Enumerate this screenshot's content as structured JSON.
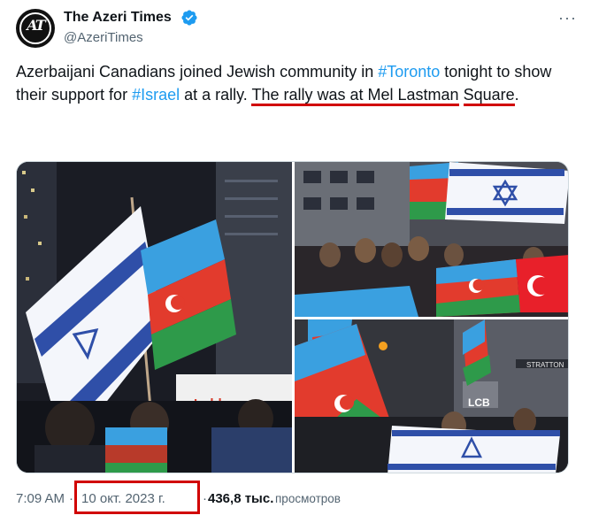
{
  "author": {
    "name": "The Azeri Times",
    "handle": "@AzeriTimes",
    "avatar_text": "AT"
  },
  "tweet": {
    "part1": "Azerbaijani Canadians joined Jewish community in ",
    "hashtag1": "#Toronto",
    "part2": " tonight to show their support for ",
    "hashtag2": "#Israel",
    "part3": " at a rally. ",
    "highlight1": "The rally was at Mel Lastman",
    "part4": " ",
    "highlight2": "Square",
    "part5": "."
  },
  "media": {
    "sign1": "Loblaws",
    "sign2": "LCB",
    "sign3": "STRATTON"
  },
  "footer": {
    "time": "7:09 AM",
    "separator": "·",
    "date": "10 окт. 2023 г.",
    "views_count": "436,8 тыс.",
    "views_label": "просмотров"
  },
  "colors": {
    "accent": "#1d9bf0",
    "annotation": "#d10000",
    "text": "#0f1419",
    "secondary": "#536471"
  },
  "icons": [
    "verified-badge-icon",
    "more-options-icon"
  ]
}
